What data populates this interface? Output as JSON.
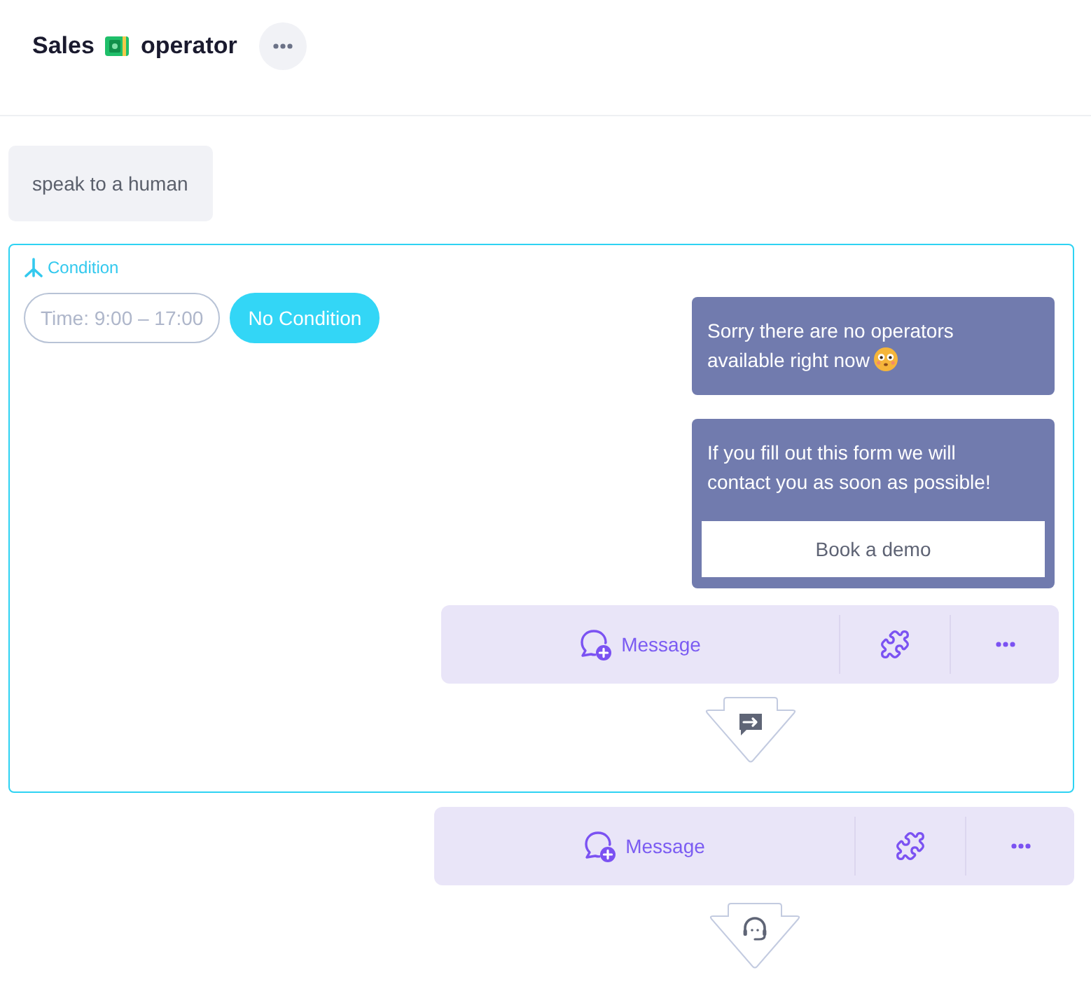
{
  "header": {
    "title_parts": [
      "Sales",
      "operator"
    ]
  },
  "user_message": {
    "text": "speak to a human"
  },
  "condition": {
    "label": "Condition",
    "options": [
      {
        "label": "Time: 9:00 – 17:00",
        "selected": false
      },
      {
        "label": "No Condition",
        "selected": true
      }
    ],
    "messages": [
      {
        "kind": "text",
        "text": "Sorry there are no operators available right now",
        "emoji": true
      },
      {
        "kind": "form",
        "text": "If you fill out this form we will contact you as soon as possible!",
        "button": "Book a demo",
        "emoji": false
      }
    ],
    "toolbar": {
      "add_label": "Message"
    },
    "connector": {
      "kind": "transfer"
    }
  },
  "toolbar": {
    "add_label": "Message"
  },
  "connector": {
    "kind": "operator"
  }
}
